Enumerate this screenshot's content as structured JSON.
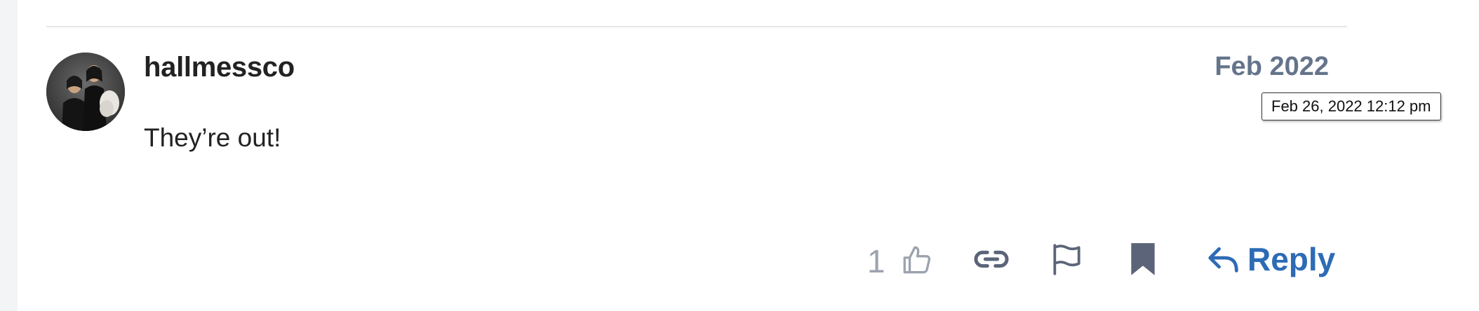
{
  "post": {
    "username": "hallmessco",
    "date": "Feb 2022",
    "date_tooltip": "Feb 26, 2022 12:12 pm",
    "body": "They’re out!",
    "like_count": "1"
  },
  "actions": {
    "reply_label": "Reply",
    "like_icon": "thumbs-up-icon",
    "link_icon": "link-icon",
    "flag_icon": "flag-icon",
    "bookmark_icon": "bookmark-icon",
    "reply_icon": "reply-arrow-icon"
  },
  "colors": {
    "accent": "#2d6bb5",
    "muted": "#64748b",
    "like_muted": "#9ca3af",
    "icon_gray": "#5b6478"
  }
}
